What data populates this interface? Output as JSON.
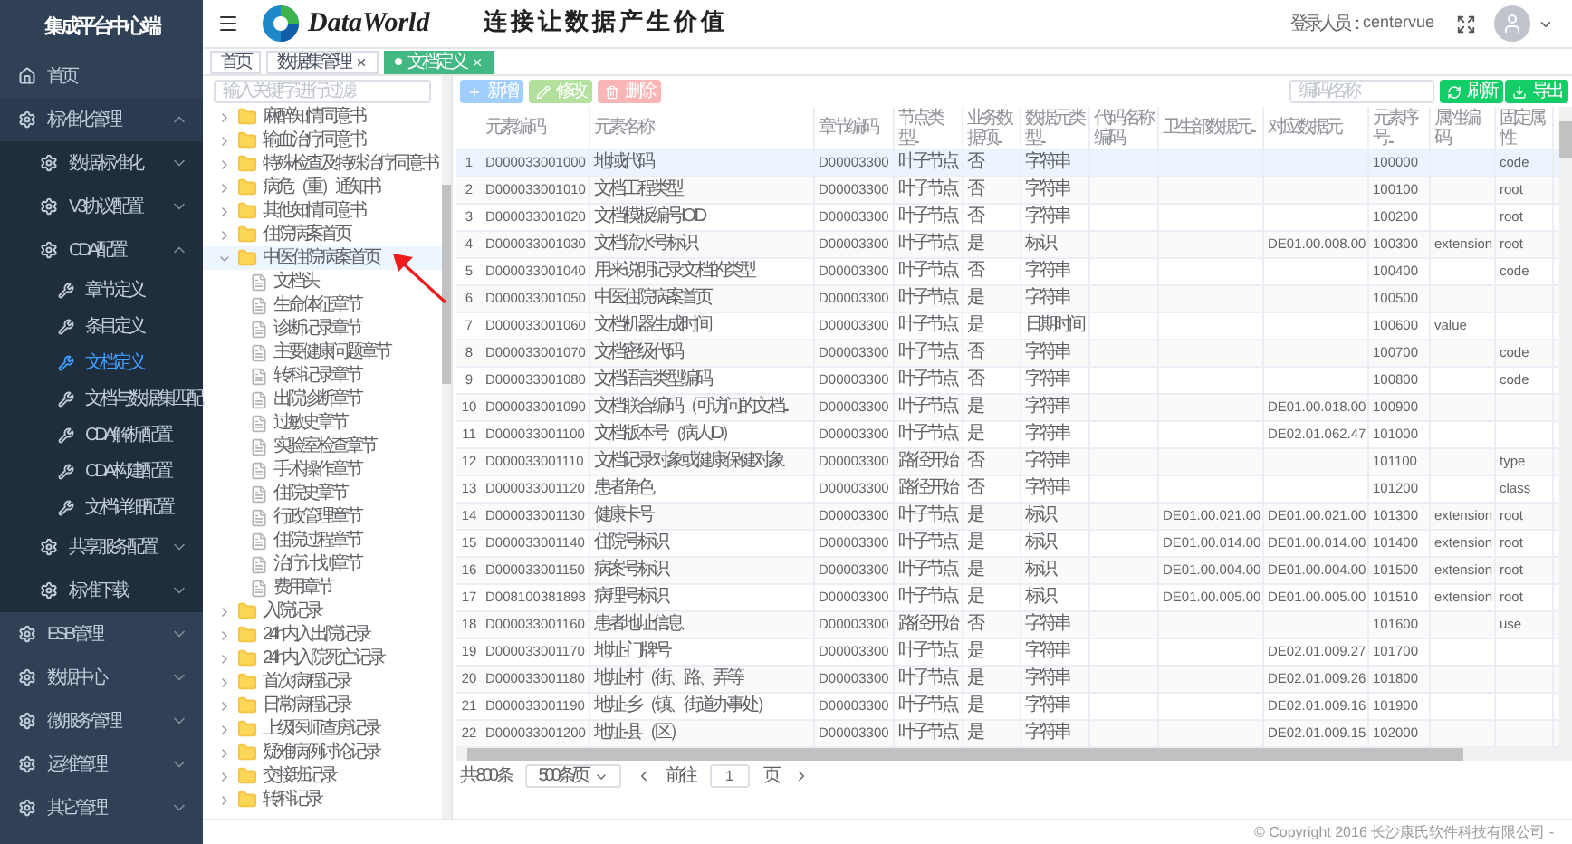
{
  "sidebar": {
    "title": "集成平台中心端",
    "menu": [
      {
        "label": "首页",
        "selected": false
      },
      {
        "label": "标准化管理",
        "expanded": true,
        "children": [
          {
            "label": "数据标准化",
            "expanded": false
          },
          {
            "label": "V3协议配置",
            "expanded": false
          },
          {
            "label": "CDA配置",
            "expanded": true,
            "children": [
              {
                "label": "章节定义",
                "selected": false
              },
              {
                "label": "条目定义",
                "selected": false
              },
              {
                "label": "文档定义",
                "selected": true
              },
              {
                "label": "文档与数据集匹配",
                "selected": false
              },
              {
                "label": "CDA解析配置",
                "selected": false
              },
              {
                "label": "CDA构建配置",
                "selected": false
              },
              {
                "label": "文档详细配置",
                "selected": false
              }
            ]
          },
          {
            "label": "共享服务配置",
            "expanded": false
          },
          {
            "label": "标准下载",
            "expanded": false
          }
        ]
      },
      {
        "label": "ESB管理",
        "expanded": false
      },
      {
        "label": "数据中心",
        "expanded": false
      },
      {
        "label": "微服务管理",
        "expanded": false
      },
      {
        "label": "运维管理",
        "expanded": false
      },
      {
        "label": "其它管理",
        "expanded": false
      }
    ]
  },
  "header": {
    "brand": "DataWorld",
    "slogan": "连接让数据产生价值",
    "user_label": "登录人员：",
    "user_name": "centervue"
  },
  "tabs": [
    {
      "label": "首页",
      "selected": false,
      "closable": false
    },
    {
      "label": "数据集管理",
      "selected": false,
      "closable": true
    },
    {
      "label": "文档定义",
      "selected": true,
      "closable": true
    }
  ],
  "tree": {
    "placeholder": "输入关键字进行过滤",
    "nodes": [
      {
        "label": "麻醉知情同意书",
        "kind": "folder",
        "expanded": false,
        "selected": false
      },
      {
        "label": "输血治疗同意书",
        "kind": "folder",
        "expanded": false,
        "selected": false
      },
      {
        "label": "特殊检查及特殊治疗同意书",
        "kind": "folder",
        "expanded": false,
        "selected": false
      },
      {
        "label": "病危（重）通知书",
        "kind": "folder",
        "expanded": false,
        "selected": false
      },
      {
        "label": "其他知情同意书",
        "kind": "folder",
        "expanded": false,
        "selected": false
      },
      {
        "label": "住院病案首页",
        "kind": "folder",
        "expanded": false,
        "selected": false
      },
      {
        "label": "中医住院病案首页",
        "kind": "folder",
        "expanded": true,
        "selected": true,
        "children": [
          {
            "label": "文档头",
            "kind": "file",
            "selected": false
          },
          {
            "label": "生命体征章节",
            "kind": "file",
            "selected": false
          },
          {
            "label": "诊断记录章节",
            "kind": "file",
            "selected": false
          },
          {
            "label": "主要健康问题章节",
            "kind": "file",
            "selected": false
          },
          {
            "label": "转科记录章节",
            "kind": "file",
            "selected": false
          },
          {
            "label": "出院诊断章节",
            "kind": "file",
            "selected": false
          },
          {
            "label": "过敏史章节",
            "kind": "file",
            "selected": false
          },
          {
            "label": "实验室检查章节",
            "kind": "file",
            "selected": false
          },
          {
            "label": "手术操作章节",
            "kind": "file",
            "selected": false
          },
          {
            "label": "住院史章节",
            "kind": "file",
            "selected": false
          },
          {
            "label": "行政管理章节",
            "kind": "file",
            "selected": false
          },
          {
            "label": "住院过程章节",
            "kind": "file",
            "selected": false
          },
          {
            "label": "治疗计划章节",
            "kind": "file",
            "selected": false
          },
          {
            "label": "费用章节",
            "kind": "file",
            "selected": false
          }
        ]
      },
      {
        "label": "入院记录",
        "kind": "folder",
        "expanded": false,
        "selected": false
      },
      {
        "label": "24h内入出院记录",
        "kind": "folder",
        "expanded": false,
        "selected": false
      },
      {
        "label": "24h内入院死亡记录",
        "kind": "folder",
        "expanded": false,
        "selected": false
      },
      {
        "label": "首次病程记录",
        "kind": "folder",
        "expanded": false,
        "selected": false
      },
      {
        "label": "日常病程记录",
        "kind": "folder",
        "expanded": false,
        "selected": false
      },
      {
        "label": "上级医师查房记录",
        "kind": "folder",
        "expanded": false,
        "selected": false
      },
      {
        "label": "疑难病例讨论记录",
        "kind": "folder",
        "expanded": false,
        "selected": false
      },
      {
        "label": "交接班记录",
        "kind": "folder",
        "expanded": false,
        "selected": false
      },
      {
        "label": "转科记录",
        "kind": "folder",
        "expanded": false,
        "selected": false
      }
    ]
  },
  "toolbar": {
    "actions": [
      {
        "label": "新增",
        "kind": "add"
      },
      {
        "label": "修改",
        "kind": "edit"
      },
      {
        "label": "删除",
        "kind": "delete"
      }
    ],
    "search": {
      "placeholder": "编码/名称"
    },
    "tools": [
      {
        "label": "刷新",
        "kind": "refresh"
      },
      {
        "label": "导出",
        "kind": "export"
      }
    ]
  },
  "table": {
    "columns": [
      {
        "label": "元素编码",
        "kind": "code"
      },
      {
        "label": "元素名称",
        "kind": "text"
      },
      {
        "label": "章节编码",
        "kind": "code"
      },
      {
        "label": "节点类型...",
        "kind": "text"
      },
      {
        "label": "业务数据项...",
        "kind": "text"
      },
      {
        "label": "数据元类型...",
        "kind": "text"
      },
      {
        "label": "代码名称编码"
      },
      {
        "label": "卫生部数据元...",
        "kind": "code"
      },
      {
        "label": "对应数据元",
        "kind": "code"
      },
      {
        "label": "元素序号...",
        "kind": "code"
      },
      {
        "label": "属性编码",
        "kind": "code"
      },
      {
        "label": "固定属性",
        "kind": "code"
      }
    ],
    "rows": [
      {
        "no": "1",
        "selected": true,
        "cells": [
          "D000033001000",
          "地域代码",
          "D00003300",
          "叶子节点",
          "否",
          "字符串",
          null,
          null,
          null,
          "100000",
          null,
          "code"
        ]
      },
      {
        "no": "2",
        "selected": false,
        "cells": [
          "D000033001010",
          "文档工程类型",
          "D00003300",
          "叶子节点",
          "否",
          "字符串",
          null,
          null,
          null,
          "100100",
          null,
          "root"
        ]
      },
      {
        "no": "3",
        "selected": false,
        "cells": [
          "D000033001020",
          "文档模板编号IOID",
          "D00003300",
          "叶子节点",
          "否",
          "字符串",
          null,
          null,
          null,
          "100200",
          null,
          "root"
        ]
      },
      {
        "no": "4",
        "selected": false,
        "cells": [
          "D000033001030",
          "文档流水号标识",
          "D00003300",
          "叶子节点",
          "是",
          "标识",
          null,
          null,
          "DE01.00.008.00",
          "100300",
          "extension",
          "root"
        ]
      },
      {
        "no": "5",
        "selected": false,
        "cells": [
          "D000033001040",
          "用来说明记录文档的类型",
          "D00003300",
          "叶子节点",
          "否",
          "字符串",
          null,
          null,
          null,
          "100400",
          null,
          "code"
        ]
      },
      {
        "no": "6",
        "selected": false,
        "cells": [
          "D000033001050",
          "中医住院病案首页",
          "D00003300",
          "叶子节点",
          "是",
          "字符串",
          null,
          null,
          null,
          "100500",
          null,
          null
        ]
      },
      {
        "no": "7",
        "selected": false,
        "cells": [
          "D000033001060",
          "文档机器生成时间",
          "D00003300",
          "叶子节点",
          "是",
          "日期时间",
          null,
          null,
          null,
          "100600",
          "value",
          null
        ]
      },
      {
        "no": "8",
        "selected": false,
        "cells": [
          "D000033001070",
          "文档密级代码",
          "D00003300",
          "叶子节点",
          "否",
          "字符串",
          null,
          null,
          null,
          "100700",
          null,
          "code"
        ]
      },
      {
        "no": "9",
        "selected": false,
        "cells": [
          "D000033001080",
          "文档语言类型编码",
          "D00003300",
          "叶子节点",
          "否",
          "字符串",
          null,
          null,
          null,
          "100800",
          null,
          "code"
        ]
      },
      {
        "no": "10",
        "selected": false,
        "cells": [
          "D000033001090",
          "文档联合编码（可访问的文档...",
          "D00003300",
          "叶子节点",
          "是",
          "字符串",
          null,
          null,
          "DE01.00.018.00",
          "100900",
          null,
          null
        ]
      },
      {
        "no": "11",
        "selected": false,
        "cells": [
          "D000033001100",
          "文档版本号（病人ID）",
          "D00003300",
          "叶子节点",
          "是",
          "字符串",
          null,
          null,
          "DE02.01.062.47",
          "101000",
          null,
          null
        ]
      },
      {
        "no": "12",
        "selected": false,
        "cells": [
          "D000033001110",
          "文档记录对象或健康保健对象",
          "D00003300",
          "路径开始",
          "否",
          "字符串",
          null,
          null,
          null,
          "101100",
          null,
          "type"
        ]
      },
      {
        "no": "13",
        "selected": false,
        "cells": [
          "D000033001120",
          "患者角色",
          "D00003300",
          "路径开始",
          "否",
          "字符串",
          null,
          null,
          null,
          "101200",
          null,
          "class"
        ]
      },
      {
        "no": "14",
        "selected": false,
        "cells": [
          "D000033001130",
          "健康卡号",
          "D00003300",
          "叶子节点",
          "是",
          "标识",
          null,
          "DE01.00.021.00",
          "DE01.00.021.00",
          "101300",
          "extension",
          "root"
        ]
      },
      {
        "no": "15",
        "selected": false,
        "cells": [
          "D000033001140",
          "住院号标识",
          "D00003300",
          "叶子节点",
          "是",
          "标识",
          null,
          "DE01.00.014.00",
          "DE01.00.014.00",
          "101400",
          "extension",
          "root"
        ]
      },
      {
        "no": "16",
        "selected": false,
        "cells": [
          "D000033001150",
          "病案号标识",
          "D00003300",
          "叶子节点",
          "是",
          "标识",
          null,
          "DE01.00.004.00",
          "DE01.00.004.00",
          "101500",
          "extension",
          "root"
        ]
      },
      {
        "no": "17",
        "selected": false,
        "cells": [
          "D008100381898",
          "病理号标识",
          "D00003300",
          "叶子节点",
          "是",
          "标识",
          null,
          "DE01.00.005.00",
          "DE01.00.005.00",
          "101510",
          "extension",
          "root"
        ]
      },
      {
        "no": "18",
        "selected": false,
        "cells": [
          "D000033001160",
          "患者地址信息",
          "D00003300",
          "路径开始",
          "否",
          "字符串",
          null,
          null,
          null,
          "101600",
          null,
          "use"
        ]
      },
      {
        "no": "19",
        "selected": false,
        "cells": [
          "D000033001170",
          "地址-门牌号",
          "D00003300",
          "叶子节点",
          "是",
          "字符串",
          null,
          null,
          "DE02.01.009.27",
          "101700",
          null,
          null
        ]
      },
      {
        "no": "20",
        "selected": false,
        "cells": [
          "D000033001180",
          "地址-村（街、路、弄等",
          "D00003300",
          "叶子节点",
          "是",
          "字符串",
          null,
          null,
          "DE02.01.009.26",
          "101800",
          null,
          null
        ]
      },
      {
        "no": "21",
        "selected": false,
        "cells": [
          "D000033001190",
          "地址-乡（镇、街道办事处）",
          "D00003300",
          "叶子节点",
          "是",
          "字符串",
          null,
          null,
          "DE02.01.009.16",
          "101900",
          null,
          null
        ]
      },
      {
        "no": "22",
        "selected": false,
        "cells": [
          "D000033001200",
          "地址-县（区）",
          "D00003300",
          "叶子节点",
          "是",
          "字符串",
          null,
          null,
          "DE02.01.009.15",
          "102000",
          null,
          null
        ]
      }
    ]
  },
  "pagination": {
    "total": "共 800 条",
    "page_size": "500条/页",
    "goto_label": "前往",
    "page": "1",
    "page_unit": "页"
  },
  "footer": {
    "copyright": "© Copyright 2016 长沙康氏软件科技有限公司 -"
  }
}
